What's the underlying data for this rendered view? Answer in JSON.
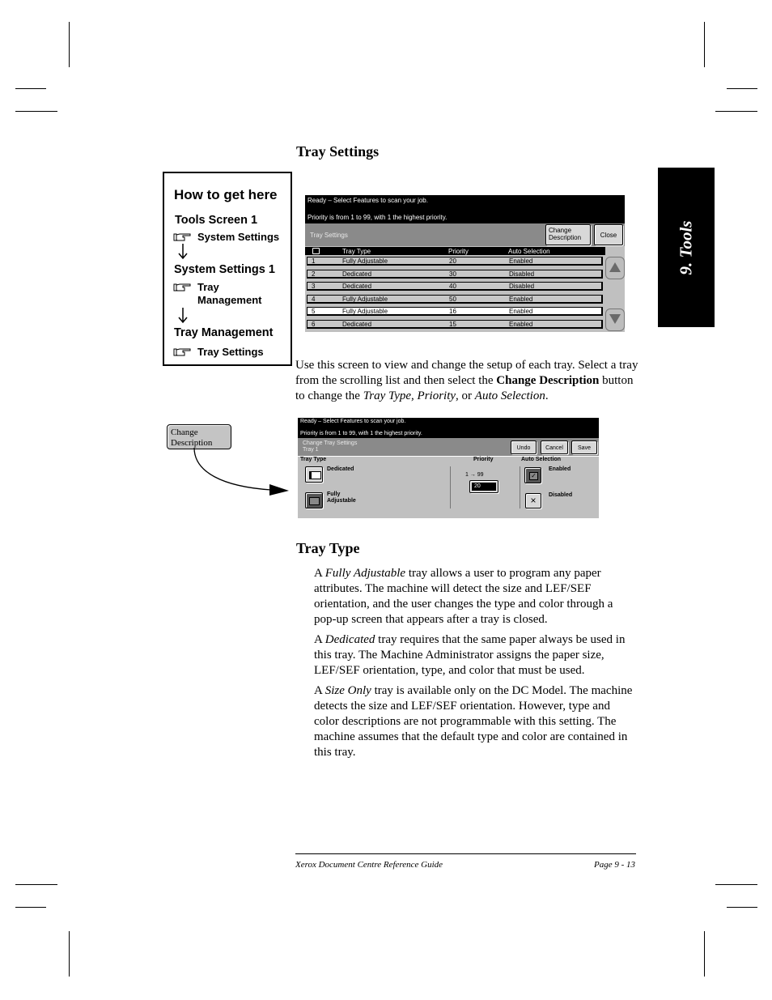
{
  "page": {
    "section_tab": "9. Tools",
    "heading_tray_settings": "Tray Settings",
    "heading_tray_type": "Tray Type"
  },
  "how_to": {
    "title": "How to get here",
    "steps": [
      {
        "screen": "Tools Screen 1",
        "action": "System Settings"
      },
      {
        "screen": "System Settings 1",
        "action_line1": "Tray",
        "action_line2": "Management"
      },
      {
        "screen": "Tray Management",
        "action": "Tray Settings"
      }
    ]
  },
  "tray_settings_screen": {
    "message_line1": "Ready –  Select Features to scan your job.",
    "message_line2": "Priority is from 1 to 99, with 1 the highest priority.",
    "title": "Tray Settings",
    "change_description_line1": "Change",
    "change_description_line2": "Description",
    "close_label": "Close",
    "columns": [
      "Tray Type",
      "Priority",
      "Auto Selection"
    ],
    "rows": [
      {
        "num": "1",
        "type": "Fully Adjustable",
        "priority": "20",
        "auto": "Enabled",
        "selected": false
      },
      {
        "num": "2",
        "type": "Dedicated",
        "priority": "30",
        "auto": "Disabled",
        "selected": false
      },
      {
        "num": "3",
        "type": "Dedicated",
        "priority": "40",
        "auto": "Disabled",
        "selected": false
      },
      {
        "num": "4",
        "type": "Fully Adjustable",
        "priority": "50",
        "auto": "Enabled",
        "selected": false
      },
      {
        "num": "5",
        "type": "Fully Adjustable",
        "priority": "16",
        "auto": "Enabled",
        "selected": true
      },
      {
        "num": "6",
        "type": "Dedicated",
        "priority": "15",
        "auto": "Enabled",
        "selected": false
      }
    ]
  },
  "intro_text": {
    "part1": "Use this screen to view and change the setup of each tray. Select a tray from the scrolling list and then select the ",
    "bold": "Change Description",
    "part2": " button to change the ",
    "i1": "Tray Type",
    "sep1": ", ",
    "i2": "Priority",
    "sep2": ", or ",
    "i3": "Auto Selection",
    "end": "."
  },
  "callout_button": {
    "line1": "Change",
    "line2": "Description"
  },
  "change_tray_screen": {
    "message_line1": "Ready –  Select Features to scan your job.",
    "message_line2": "Priority is from 1 to 99, with 1 the highest priority.",
    "title_line1": "Change Tray Settings",
    "title_line2": "Tray 1",
    "undo_label": "Undo",
    "cancel_label": "Cancel",
    "save_label": "Save",
    "tray_type_label": "Tray Type",
    "dedicated_label": "Dedicated",
    "fully_line1": "Fully",
    "fully_line2": "Adjustable",
    "priority_label": "Priority",
    "priority_range": "1 → 99",
    "priority_value": "20",
    "auto_label": "Auto Selection",
    "enabled_label": "Enabled",
    "disabled_label": "Disabled"
  },
  "tray_type_paragraphs": [
    {
      "pre": "A ",
      "italic": "Fully Adjustable",
      "post": " tray allows a user to program any paper attributes. The machine will detect the size and LEF/SEF orientation, and the user changes the type and color through a pop-up screen that appears after a tray is closed."
    },
    {
      "pre": "A ",
      "italic": "Dedicated",
      "post": " tray requires that the same paper always be used in this tray. The Machine Administrator assigns the paper size, LEF/SEF orientation, type, and color that must be used."
    },
    {
      "pre": "A ",
      "italic": "Size Only",
      "post": " tray is available only on the DC Model. The machine detects the size and LEF/SEF orientation. However, type and color descriptions are not programmable with this setting. The machine assumes that the default type and color are contained in this tray."
    }
  ],
  "footer": {
    "left": "Xerox Document Centre Reference Guide",
    "right": "Page 9 - 13"
  }
}
